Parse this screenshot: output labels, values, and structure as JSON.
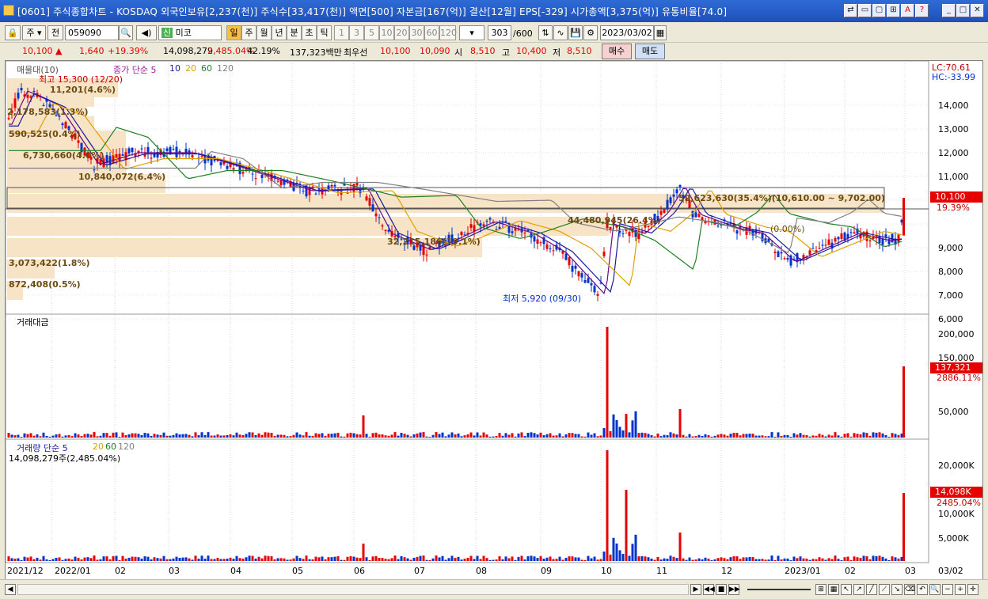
{
  "window": {
    "title": "[0601] 주식종합차트 - KOSDAQ 외국인보유[2,237(천)] 주식수[33,417(천)] 액면[500] 자본금[167(억)] 결산[12월] EPS[-329] 시가총액[3,375(억)] 유통비율[74.0]"
  },
  "toolbar": {
    "type_select": "주",
    "prev_label": "전",
    "code": "059090",
    "stock_name": "미코",
    "stock_badge": "신",
    "periods": [
      "일",
      "주",
      "월",
      "년",
      "분",
      "초",
      "틱"
    ],
    "intervals": [
      "1",
      "3",
      "5",
      "10",
      "20",
      "30",
      "60",
      "120"
    ],
    "count": "303",
    "count_max": "/600",
    "date": "2023/03/02"
  },
  "quote": {
    "price": "10,100",
    "change_arrow": "▲",
    "change": "1,640",
    "change_pct": "+19.39%",
    "volume": "14,098,279",
    "volume_ratio": "2,485.04%",
    "turnover": "42.19%",
    "amount": "137,323백만",
    "best_label": "최우선",
    "best_ask": "10,100",
    "best_bid": "10,090",
    "open_label": "시",
    "open": "8,510",
    "high_label": "고",
    "high": "10,400",
    "low_label": "저",
    "low": "8,510",
    "buy_label": "매수",
    "sell_label": "매도"
  },
  "price_panel": {
    "legend_title": "매물대(10)",
    "legend_ma": "종가 단순 5",
    "ma_periods": [
      "5",
      "10",
      "20",
      "60",
      "120"
    ],
    "lc": "LC:70.61",
    "hc": "HC:-33.99",
    "max_label": "최고 15,300 (12/20)",
    "min_label": "최저 5,920 (09/30)",
    "last_price": "10,100",
    "last_pct": "19.39%",
    "ylabels": [
      "14,000",
      "13,000",
      "12,000",
      "11,000",
      "10,000",
      "9,000",
      "8,000",
      "7,000",
      "6,000"
    ],
    "profile": [
      {
        "text": "11,201(4.6%)"
      },
      {
        "text": "2,178,583(1.3%)"
      },
      {
        "text": "590,525(0.4%)"
      },
      {
        "text": "6,730,660(4.0%)"
      },
      {
        "text": "10,840,072(6.4%)"
      },
      {
        "text": "59,623,630(35.4%)(10,610.00 ~ 9,702.00)"
      },
      {
        "text": "44,480,945(26.4%)"
      },
      {
        "text": "32,215,186(19.1%)"
      },
      {
        "text": "(0.00%)"
      },
      {
        "text": "3,073,422(1.8%)"
      },
      {
        "text": "872,408(0.5%)"
      }
    ]
  },
  "amount_panel": {
    "title": "거래대금",
    "ylabels": [
      "200,000",
      "150,000",
      "50,000"
    ],
    "last_value": "137,321",
    "last_pct": "2886.11%"
  },
  "volume_panel": {
    "title": "거래량 단순 5",
    "ma_periods": [
      "5",
      "20",
      "60",
      "120"
    ],
    "info": "14,098,279주(2,485.04%)",
    "ylabels": [
      "20,000K",
      "15,000K",
      "10,000K",
      "5,000K"
    ],
    "last_value": "14,098K",
    "last_pct": "2485.04%"
  },
  "x_axis": [
    "2021/12",
    "2022/01",
    "02",
    "03",
    "04",
    "05",
    "06",
    "07",
    "08",
    "09",
    "10",
    "11",
    "12",
    "2023/01",
    "02",
    "03",
    "03/02"
  ],
  "colors": {
    "up": "#e60000",
    "down": "#0033cc",
    "ma5": "#6a0a8a",
    "ma10": "#1a1aa0",
    "ma20": "#e0a000",
    "ma60": "#208020",
    "ma120": "#808080",
    "profile": "#f7e3c6"
  }
}
